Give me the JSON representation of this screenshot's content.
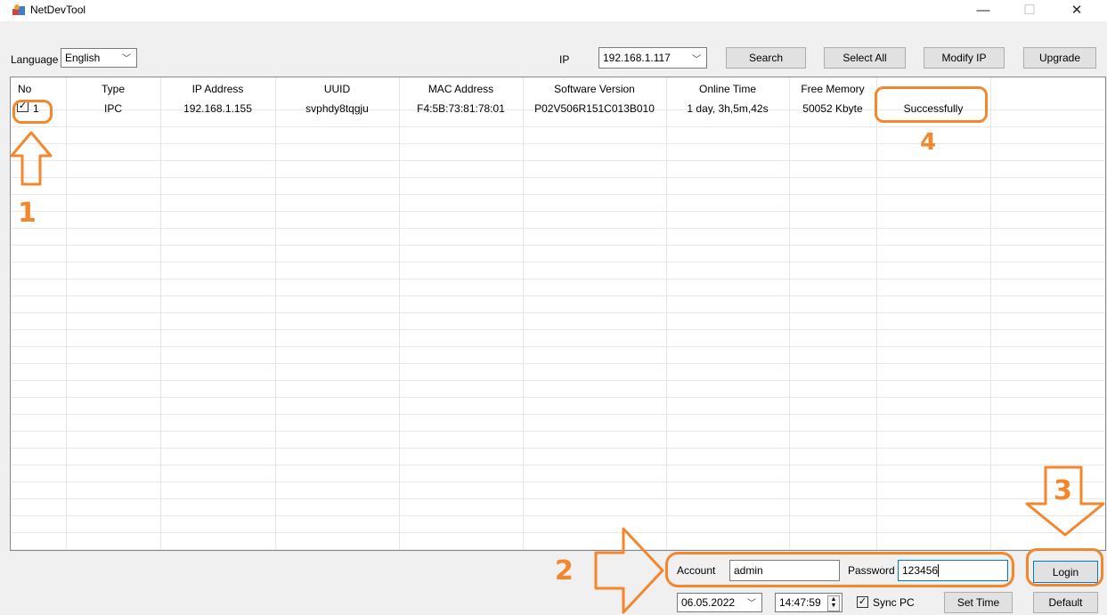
{
  "window": {
    "title": "NetDevTool",
    "minimize_icon": "minimize-icon",
    "maximize_icon": "maximize-icon",
    "close_icon": "close-icon"
  },
  "toolbar": {
    "language_label": "Language",
    "language_value": "English",
    "ip_label": "IP",
    "ip_value": "192.168.1.117",
    "search_label": "Search",
    "select_all_label": "Select All",
    "modify_ip_label": "Modify IP",
    "upgrade_label": "Upgrade"
  },
  "table": {
    "headers": [
      "No",
      "Type",
      "IP Address",
      "UUID",
      "MAC Address",
      "Software Version",
      "Online Time",
      "Free Memory"
    ],
    "rows": [
      {
        "checked": true,
        "no": "1",
        "type": "IPC",
        "ip": "192.168.1.155",
        "uuid": "svphdy8tqgju",
        "mac": "F4:5B:73:81:78:01",
        "software": "P02V506R151C013B010",
        "online": "1 day, 3h,5m,42s",
        "memory": "50052 Kbyte",
        "status": "Successfully"
      }
    ]
  },
  "login": {
    "account_label": "Account",
    "account_value": "admin",
    "password_label": "Password",
    "password_value": "123456",
    "login_label": "Login",
    "default_label": "Default"
  },
  "datetime": {
    "date_value": "06.05.2022",
    "time_value": "14:47:59",
    "sync_label": "Sync PC",
    "sync_checked": true,
    "set_time_label": "Set Time"
  },
  "annotations": {
    "color": "#f4862b",
    "step1": "1",
    "step2": "2",
    "step3": "3",
    "step4": "4"
  }
}
